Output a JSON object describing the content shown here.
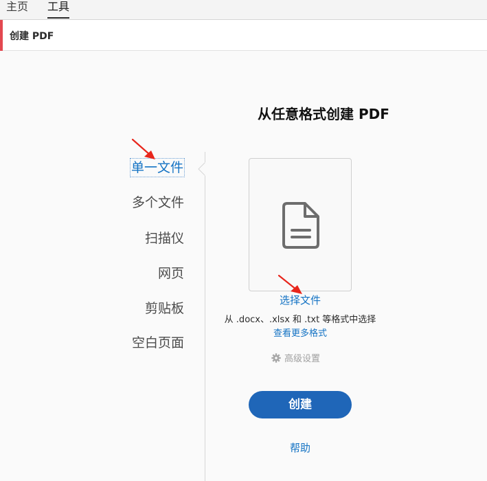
{
  "top_tabs": {
    "home": "主页",
    "tools": "工具"
  },
  "tool_header": {
    "title": "创建 PDF"
  },
  "main": {
    "title": "从任意格式创建 PDF",
    "select_file": "选择文件",
    "hint": "从 .docx、.xlsx 和 .txt 等格式中选择",
    "more_formats": "查看更多格式",
    "advanced": "高级设置",
    "create_button": "创建",
    "help": "帮助"
  },
  "sidebar": {
    "items": [
      {
        "label": "单一文件",
        "active": true
      },
      {
        "label": "多个文件"
      },
      {
        "label": "扫描仪"
      },
      {
        "label": "网页"
      },
      {
        "label": "剪贴板"
      },
      {
        "label": "空白页面"
      }
    ]
  },
  "colors": {
    "accent_red": "#e34850",
    "link_blue": "#1473c4",
    "button_blue": "#1f66b8",
    "annotation_red": "#e8261c"
  },
  "icons": [
    "document-icon",
    "gear-icon",
    "annotation-arrow"
  ]
}
